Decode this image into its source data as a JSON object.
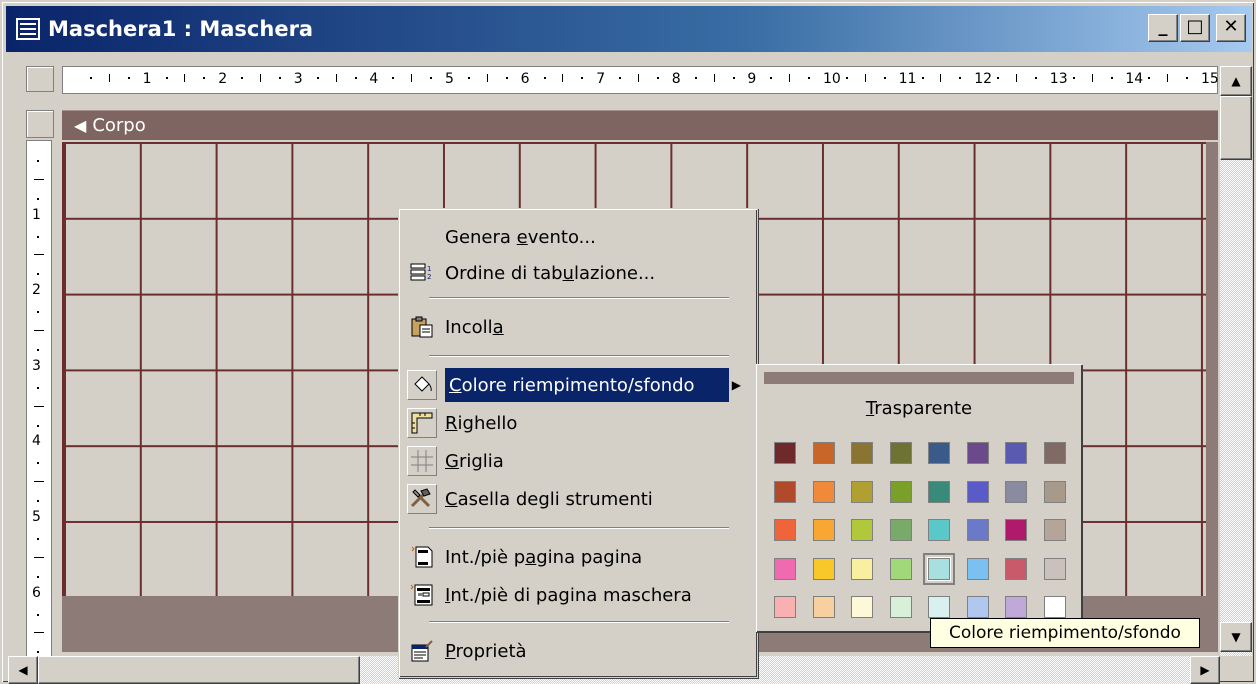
{
  "window": {
    "title": "Maschera1 : Maschera",
    "buttons": {
      "minimize": "_",
      "maximize": "□",
      "close": "✕"
    }
  },
  "ruler": {
    "horizontal": [
      "1",
      "2",
      "3",
      "4",
      "5",
      "6",
      "7",
      "8",
      "9",
      "10",
      "11",
      "12",
      "13",
      "14",
      "15"
    ],
    "vertical": [
      "1",
      "2",
      "3",
      "4",
      "5",
      "6"
    ]
  },
  "section": {
    "label": "Corpo",
    "arrow": "◀"
  },
  "context_menu": {
    "items": [
      {
        "id": "genera-evento",
        "label_pre": "Genera ",
        "mnemonic": "e",
        "label_post": "vento...",
        "icon": "none"
      },
      {
        "id": "ordine-tabulazione",
        "label_pre": "Ordine di tab",
        "mnemonic": "u",
        "label_post": "lazione...",
        "icon": "tab-order-icon"
      },
      {
        "id": "incolla",
        "label_pre": "Incoll",
        "mnemonic": "a",
        "label_post": "",
        "icon": "paste-icon"
      },
      {
        "id": "colore-riempimento",
        "label_pre": "",
        "mnemonic": "C",
        "label_post": "olore riempimento/sfondo",
        "icon": "fill-color-icon",
        "submenu": "▶"
      },
      {
        "id": "righello",
        "label_pre": "",
        "mnemonic": "R",
        "label_post": "ighello",
        "icon": "ruler-icon"
      },
      {
        "id": "griglia",
        "label_pre": "",
        "mnemonic": "G",
        "label_post": "riglia",
        "icon": "grid-icon"
      },
      {
        "id": "casella-strumenti",
        "label_pre": "",
        "mnemonic": "C",
        "label_post": "asella degli strumenti",
        "icon": "toolbox-icon"
      },
      {
        "id": "int-pie-pagina",
        "label_pre": "Int./piè p",
        "mnemonic": "a",
        "label_post": "gina pagina",
        "icon": "page-header-icon"
      },
      {
        "id": "int-pie-maschera",
        "label_pre": "",
        "mnemonic": "I",
        "label_post": "nt./piè di pagina maschera",
        "icon": "form-header-icon"
      },
      {
        "id": "proprieta",
        "label_pre": "",
        "mnemonic": "P",
        "label_post": "roprietà",
        "icon": "properties-icon"
      }
    ]
  },
  "palette": {
    "transparent_mnemonic": "T",
    "transparent_rest": "rasparente",
    "colors": [
      [
        "#6e2a2a",
        "#c8662a",
        "#8a7432",
        "#6e7232",
        "#3a5a8a",
        "#6a4a8a",
        "#5a5ab0",
        "#806a64"
      ],
      [
        "#b04a2a",
        "#f08a3a",
        "#b0a032",
        "#7aa02a",
        "#3a8a7a",
        "#5a5ac8",
        "#8a8aa0",
        "#a89a8a"
      ],
      [
        "#f0643a",
        "#f8a832",
        "#b0c83a",
        "#7aaa6a",
        "#5ac8c8",
        "#6a7ac8",
        "#b01a6a",
        "#b4a49a"
      ],
      [
        "#f06ab0",
        "#f8c82a",
        "#f8f0a0",
        "#a0d87a",
        "#a8e0e0",
        "#7ac0f0",
        "#c85a6a",
        "#cac0bc"
      ],
      [
        "#f8b0b0",
        "#f8d0a0",
        "#fcf8d8",
        "#d8f0d8",
        "#d8f0f0",
        "#b0c8f0",
        "#c0a8d8",
        "#ffffff"
      ]
    ],
    "selected": [
      3,
      4
    ]
  },
  "tooltip": {
    "text": "Colore riempimento/sfondo"
  }
}
